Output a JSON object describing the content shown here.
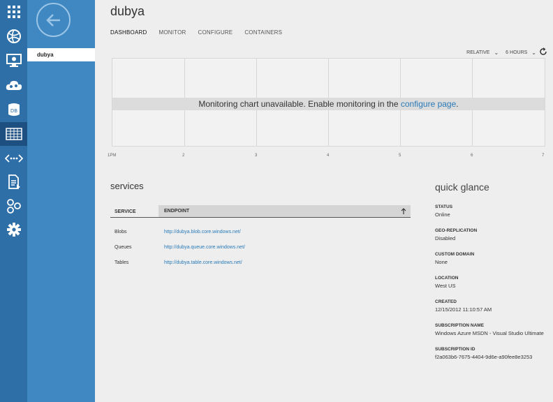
{
  "app": {
    "title": "dubya"
  },
  "rail": {
    "items": [
      {
        "name": "all-items-icon",
        "active": false
      },
      {
        "name": "web-sites-icon",
        "active": false
      },
      {
        "name": "virtual-machines-icon",
        "active": false
      },
      {
        "name": "cloud-services-icon",
        "active": false
      },
      {
        "name": "sql-databases-icon",
        "active": false,
        "text": "DB"
      },
      {
        "name": "storage-icon",
        "active": true
      },
      {
        "name": "service-bus-icon",
        "active": false
      },
      {
        "name": "media-services-icon",
        "active": false
      },
      {
        "name": "networks-icon",
        "active": false
      },
      {
        "name": "settings-icon",
        "active": false
      }
    ]
  },
  "panel": {
    "back_icon": "back-arrow-icon",
    "selected_item": "dubya"
  },
  "tabs": [
    {
      "label": "DASHBOARD",
      "active": true
    },
    {
      "label": "MONITOR",
      "active": false
    },
    {
      "label": "CONFIGURE",
      "active": false
    },
    {
      "label": "CONTAINERS",
      "active": false
    }
  ],
  "range": {
    "mode": "RELATIVE",
    "period": "6 HOURS"
  },
  "chart": {
    "message": "Monitoring chart unavailable. Enable monitoring in the ",
    "link": "configure page",
    "period": ".",
    "xticks": [
      "1PM",
      "2",
      "3",
      "4",
      "5",
      "6",
      "7"
    ]
  },
  "services": {
    "title": "services",
    "columns": [
      "SERVICE",
      "ENDPOINT"
    ],
    "rows": [
      {
        "service": "Blobs",
        "endpoint": "http://dubya.blob.core.windows.net/"
      },
      {
        "service": "Queues",
        "endpoint": "http://dubya.queue.core.windows.net/"
      },
      {
        "service": "Tables",
        "endpoint": "http://dubya.table.core.windows.net/"
      }
    ]
  },
  "glance": {
    "title": "quick glance",
    "items": [
      {
        "label": "STATUS",
        "value": "Online"
      },
      {
        "label": "GEO-REPLICATION",
        "value": "Disabled"
      },
      {
        "label": "CUSTOM DOMAIN",
        "value": "None"
      },
      {
        "label": "LOCATION",
        "value": "West US"
      },
      {
        "label": "CREATED",
        "value": "12/15/2012 11:10:57 AM"
      },
      {
        "label": "SUBSCRIPTION NAME",
        "value": "Windows Azure MSDN - Visual Studio Ultimate"
      },
      {
        "label": "SUBSCRIPTION ID",
        "value": "f2a063b6-7675-4404-9d6e-a90fee8e3253"
      }
    ]
  },
  "colors": {
    "rail": "#2f6fa8",
    "panel": "#3f88c2",
    "link": "#2a7ab8",
    "background": "#eeeeee"
  }
}
